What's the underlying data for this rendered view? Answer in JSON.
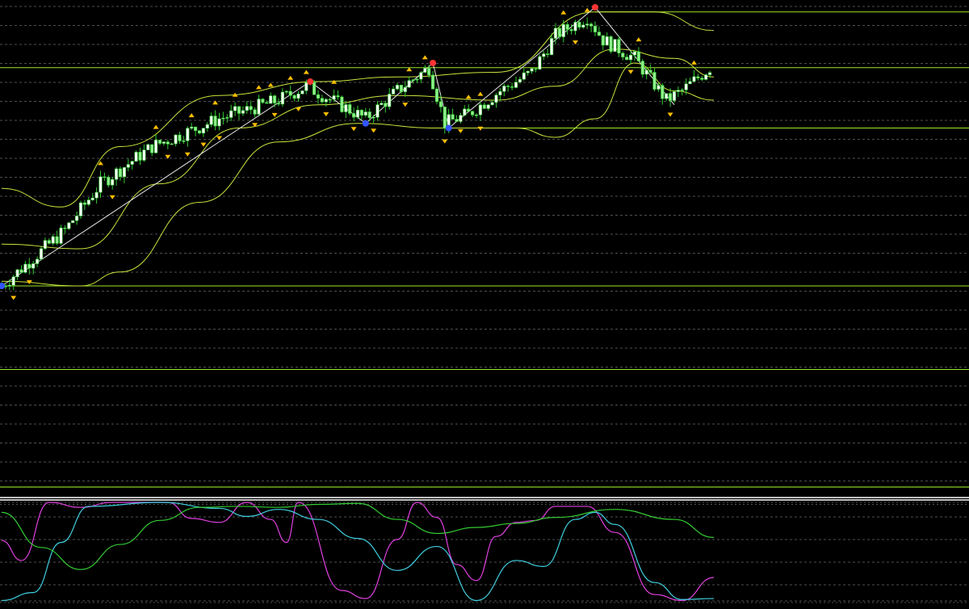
{
  "colors": {
    "background": "#000000",
    "grid": "#6b6b6b",
    "candle_up_body": "#ffffff",
    "candle_up_border": "#33cc33",
    "candle_down_body": "#8ef08a",
    "wick": "#32cd32",
    "bands": "#c8e63c",
    "zigzag": "#e6e6e6",
    "level_line": "#adff2f",
    "fractal_arrow": "#ffbf00",
    "peak_marker": "#ff3333",
    "trough_marker": "#3355ff",
    "osc_magenta": "#e040e0",
    "osc_cyan": "#40d0e0",
    "osc_green": "#33cc33",
    "separator": "#ffffff"
  },
  "chart_data": [
    {
      "type": "candlestick",
      "panel": "price",
      "grid": true,
      "ylim": [
        0,
        100
      ],
      "bar_count": 180,
      "anchors": [
        {
          "bar": 0,
          "price": 48
        },
        {
          "bar": 8,
          "price": 54
        },
        {
          "bar": 16,
          "price": 60
        },
        {
          "bar": 25,
          "price": 70
        },
        {
          "bar": 38,
          "price": 78
        },
        {
          "bar": 55,
          "price": 84
        },
        {
          "bar": 70,
          "price": 88
        },
        {
          "bar": 77,
          "price": 91
        },
        {
          "bar": 92,
          "price": 84
        },
        {
          "bar": 100,
          "price": 90
        },
        {
          "bar": 108,
          "price": 95
        },
        {
          "bar": 112,
          "price": 83
        },
        {
          "bar": 118,
          "price": 85
        },
        {
          "bar": 126,
          "price": 90
        },
        {
          "bar": 134,
          "price": 94
        },
        {
          "bar": 140,
          "price": 102
        },
        {
          "bar": 148,
          "price": 106
        },
        {
          "bar": 152,
          "price": 101
        },
        {
          "bar": 160,
          "price": 97
        },
        {
          "bar": 168,
          "price": 88
        },
        {
          "bar": 172,
          "price": 90
        },
        {
          "bar": 179,
          "price": 95
        }
      ],
      "zigzag": [
        {
          "bar": 0,
          "price": 48
        },
        {
          "bar": 78,
          "price": 92
        },
        {
          "bar": 92,
          "price": 83
        },
        {
          "bar": 109,
          "price": 96
        },
        {
          "bar": 113,
          "price": 82
        },
        {
          "bar": 150,
          "price": 108
        },
        {
          "bar": 170,
          "price": 87
        }
      ],
      "bands": {
        "upper": [
          [
            0,
            69
          ],
          [
            15,
            65
          ],
          [
            30,
            78
          ],
          [
            55,
            89
          ],
          [
            80,
            92
          ],
          [
            100,
            93
          ],
          [
            125,
            94
          ],
          [
            150,
            107
          ],
          [
            165,
            107
          ],
          [
            180,
            103
          ]
        ],
        "middle": [
          [
            0,
            57
          ],
          [
            20,
            56
          ],
          [
            40,
            70
          ],
          [
            60,
            82
          ],
          [
            80,
            87
          ],
          [
            100,
            89
          ],
          [
            125,
            88
          ],
          [
            140,
            91
          ],
          [
            155,
            99
          ],
          [
            170,
            97
          ],
          [
            180,
            93
          ]
        ],
        "lower": [
          [
            0,
            49
          ],
          [
            20,
            48
          ],
          [
            30,
            51
          ],
          [
            50,
            66
          ],
          [
            70,
            79
          ],
          [
            90,
            83
          ],
          [
            110,
            82
          ],
          [
            130,
            82
          ],
          [
            140,
            80
          ],
          [
            150,
            84
          ],
          [
            160,
            96
          ],
          [
            170,
            90
          ],
          [
            180,
            88
          ]
        ]
      },
      "levels": [
        {
          "price": 107,
          "from_bar": 150
        },
        {
          "price": 95
        },
        {
          "price": 82,
          "from_bar": 113
        },
        {
          "price": 48
        },
        {
          "price": 30
        }
      ],
      "peaks": [
        {
          "bar": 78,
          "price": 92
        },
        {
          "bar": 109,
          "price": 96
        },
        {
          "bar": 150,
          "price": 108
        }
      ],
      "troughs": [
        {
          "bar": 0,
          "price": 48
        },
        {
          "bar": 92,
          "price": 83
        },
        {
          "bar": 113,
          "price": 82
        }
      ]
    },
    {
      "type": "line",
      "panel": "oscillator",
      "grid": true,
      "ylim": [
        0,
        100
      ],
      "series": [
        {
          "color_key": "osc_magenta",
          "points": [
            [
              0,
              62
            ],
            [
              5,
              42
            ],
            [
              12,
              100
            ],
            [
              20,
              95
            ],
            [
              28,
              100
            ],
            [
              42,
              100
            ],
            [
              48,
              84
            ],
            [
              55,
              80
            ],
            [
              62,
              100
            ],
            [
              68,
              83
            ],
            [
              72,
              60
            ],
            [
              75,
              100
            ],
            [
              86,
              12
            ],
            [
              92,
              4
            ],
            [
              100,
              63
            ],
            [
              105,
              100
            ],
            [
              110,
              85
            ],
            [
              115,
              38
            ],
            [
              120,
              22
            ],
            [
              125,
              66
            ],
            [
              130,
              80
            ],
            [
              135,
              82
            ],
            [
              140,
              96
            ],
            [
              148,
              96
            ],
            [
              155,
              70
            ],
            [
              165,
              8
            ],
            [
              172,
              2
            ],
            [
              180,
              25
            ]
          ]
        },
        {
          "color_key": "osc_cyan",
          "points": [
            [
              0,
              2
            ],
            [
              8,
              10
            ],
            [
              15,
              60
            ],
            [
              22,
              96
            ],
            [
              40,
              100
            ],
            [
              55,
              94
            ],
            [
              62,
              86
            ],
            [
              70,
              93
            ],
            [
              80,
              83
            ],
            [
              90,
              64
            ],
            [
              100,
              32
            ],
            [
              110,
              56
            ],
            [
              120,
              2
            ],
            [
              130,
              42
            ],
            [
              137,
              36
            ],
            [
              145,
              83
            ],
            [
              150,
              90
            ],
            [
              155,
              78
            ],
            [
              165,
              20
            ],
            [
              172,
              3
            ],
            [
              180,
              4
            ]
          ]
        },
        {
          "color_key": "osc_green",
          "points": [
            [
              0,
              90
            ],
            [
              10,
              55
            ],
            [
              20,
              33
            ],
            [
              30,
              58
            ],
            [
              40,
              82
            ],
            [
              50,
              95
            ],
            [
              60,
              96
            ],
            [
              70,
              95
            ],
            [
              80,
              98
            ],
            [
              90,
              99
            ],
            [
              100,
              83
            ],
            [
              110,
              69
            ],
            [
              120,
              75
            ],
            [
              130,
              79
            ],
            [
              140,
              85
            ],
            [
              155,
              93
            ],
            [
              170,
              83
            ],
            [
              180,
              65
            ]
          ]
        }
      ],
      "levels": [
        100,
        98,
        0
      ]
    }
  ]
}
